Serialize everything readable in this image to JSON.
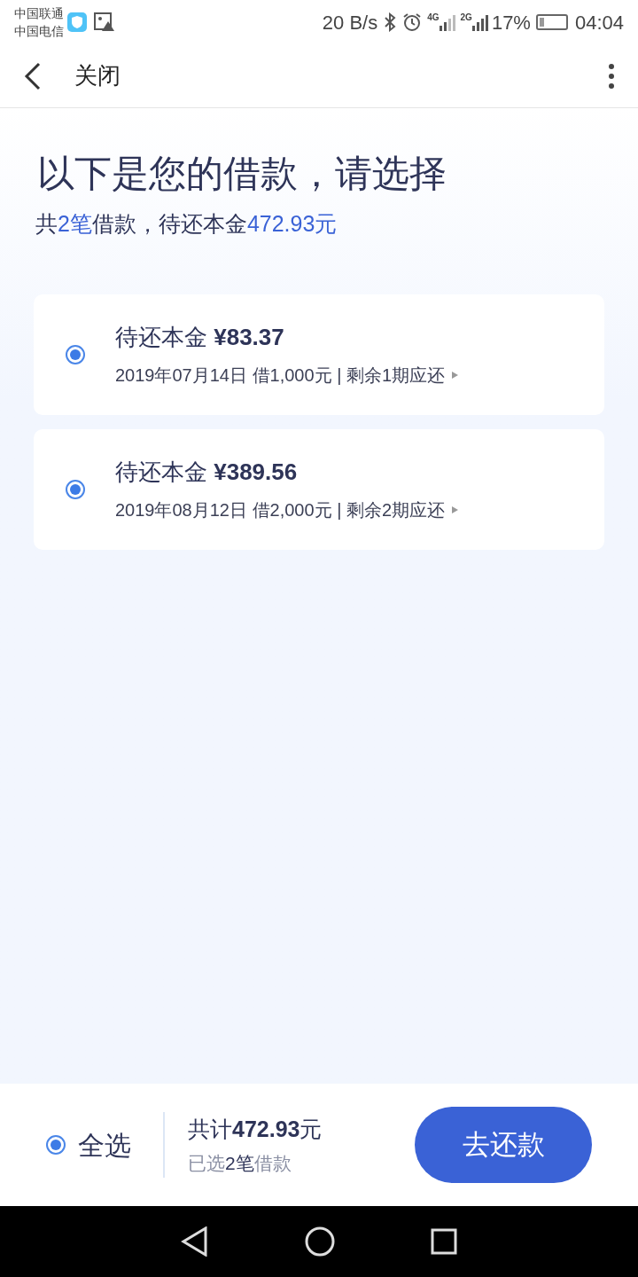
{
  "status_bar": {
    "carriers": [
      "中国联通",
      "中国电信"
    ],
    "speed": "20 B/s",
    "network_1": "4G",
    "network_2": "2G",
    "battery": "17%",
    "time": "04:04"
  },
  "header": {
    "title": "关闭"
  },
  "heading": "以下是您的借款，请选择",
  "summary": [
    {
      "text": "共",
      "highlight": false
    },
    {
      "text": "2笔",
      "highlight": true
    },
    {
      "text": "借款，待还本金",
      "highlight": false
    },
    {
      "text": "472.93元",
      "highlight": true
    }
  ],
  "loans": [
    {
      "principal": "待还本金 **¥83.37**",
      "details": "2019年07月14日 借1,000元 | 剩余1期应还",
      "selected": true
    },
    {
      "principal": "待还本金 **¥389.56**",
      "details": "2019年08月12日 借2,000元 | 剩余2期应还",
      "selected": true
    }
  ],
  "footer": {
    "select_all": {
      "label": "全选",
      "selected": true
    },
    "total": "共计**472.93**元",
    "selected_count": [
      {
        "text": "已选",
        "highlight": false
      },
      {
        "text": "2笔",
        "highlight": true
      },
      {
        "text": "借款",
        "highlight": false
      }
    ],
    "pay_button": "去还款"
  }
}
